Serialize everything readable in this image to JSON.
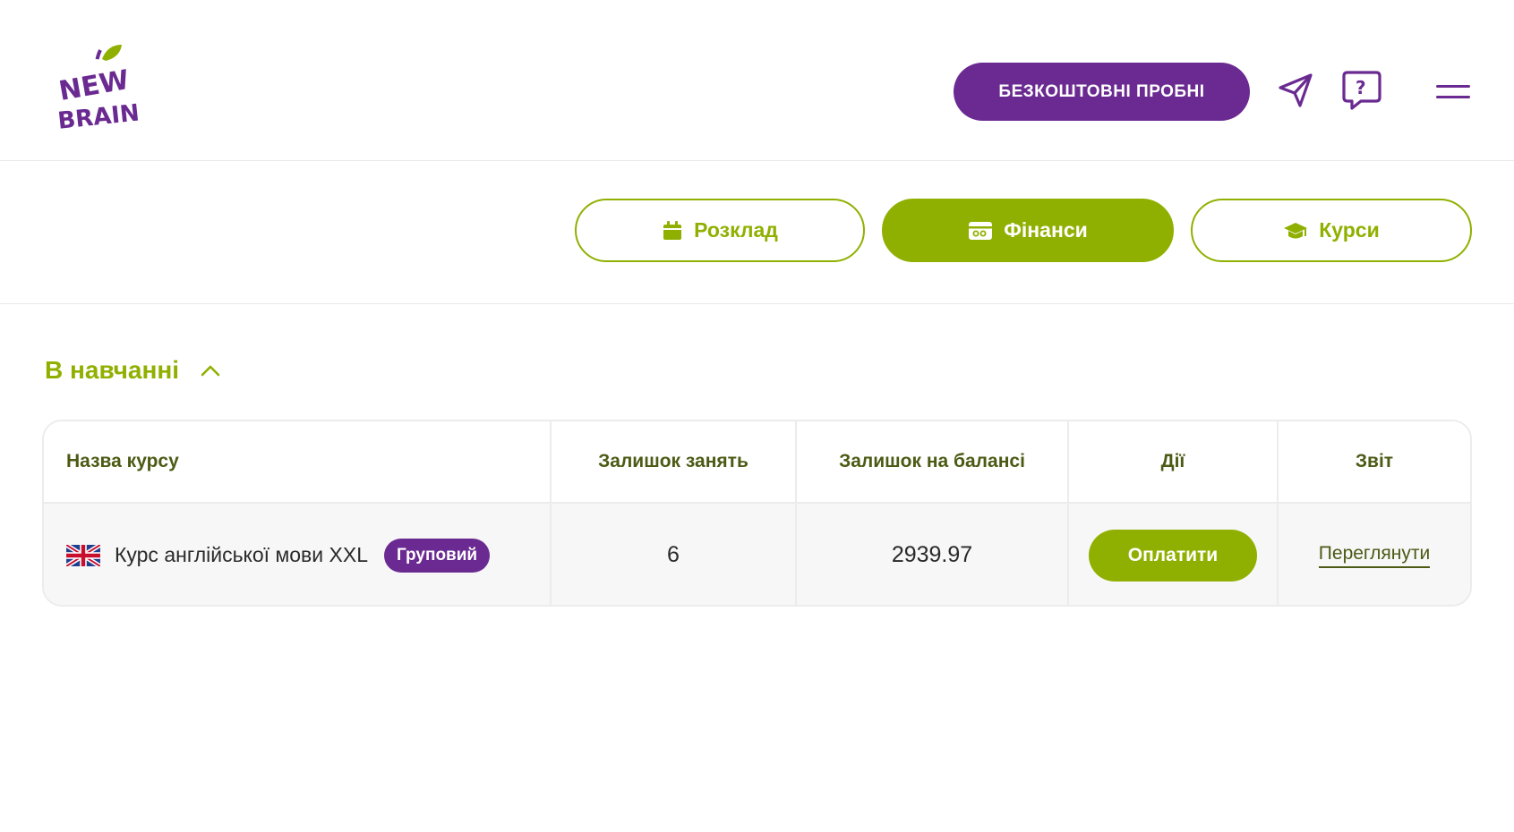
{
  "header": {
    "logo_line1": "NEW",
    "logo_line2": "BRAIN",
    "trial_button": "БЕЗКОШТОВНІ  ПРОБНІ",
    "icons": [
      "send-icon",
      "help-icon",
      "menu-icon"
    ]
  },
  "nav": {
    "schedule": "Розклад",
    "finance": "Фінанси",
    "courses": "Курси",
    "active": "finance"
  },
  "section": {
    "title": "В навчанні",
    "expanded": true
  },
  "table": {
    "columns": [
      "Назва курсу",
      "Залишок занять",
      "Залишок на балансі",
      "Дії",
      "Звіт"
    ],
    "rows": [
      {
        "course": "Курс англійської мови XXL",
        "type": "Груповий",
        "lessons_left": "6",
        "balance": "2939.97",
        "action": "Оплатити",
        "report": "Переглянути"
      }
    ]
  },
  "colors": {
    "purple": "#6a2a91",
    "green": "#8fb000",
    "dark_green_text": "#4b5a14"
  }
}
